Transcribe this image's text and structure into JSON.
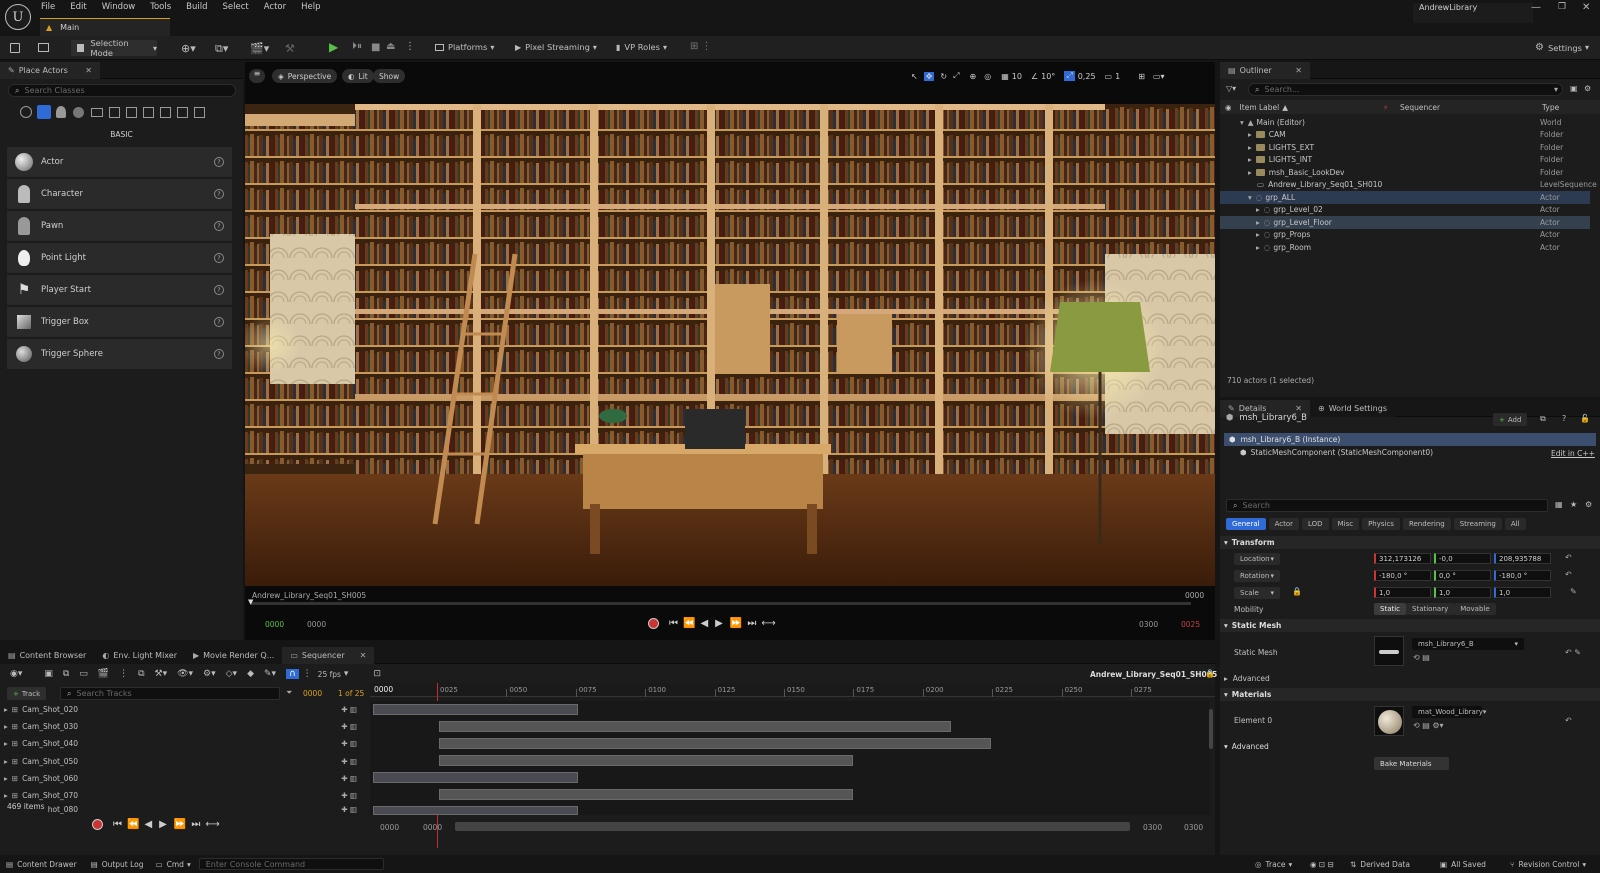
{
  "menu": {
    "items": [
      "File",
      "Edit",
      "Window",
      "Tools",
      "Build",
      "Select",
      "Actor",
      "Help"
    ],
    "project": "AndrewLibrary"
  },
  "tab": {
    "main": "Main"
  },
  "toolbar": {
    "selection_mode": "Selection Mode",
    "platforms": "Platforms",
    "pixel_streaming": "Pixel Streaming",
    "vp_roles": "VP Roles",
    "settings": "Settings"
  },
  "place_actors": {
    "title": "Place Actors",
    "search_placeholder": "Search Classes",
    "category": "BASIC",
    "items": [
      {
        "label": "Actor",
        "icon": "sphere-icon"
      },
      {
        "label": "Character",
        "icon": "character-icon"
      },
      {
        "label": "Pawn",
        "icon": "pawn-icon"
      },
      {
        "label": "Point Light",
        "icon": "bulb-icon"
      },
      {
        "label": "Player Start",
        "icon": "flag-icon"
      },
      {
        "label": "Trigger Box",
        "icon": "cube-icon"
      },
      {
        "label": "Trigger Sphere",
        "icon": "sphere-icon"
      }
    ]
  },
  "viewport": {
    "perspective": "Perspective",
    "lit": "Lit",
    "show": "Show",
    "grid": "10",
    "angle": "10°",
    "scale": "0,25",
    "cams": "1",
    "shot_name": "Andrew_Library_Seq01_SH005",
    "frame_right": "0000",
    "t_start": "0000",
    "t_start2": "0000",
    "t_end": "0300",
    "t_end2": "0025"
  },
  "outliner": {
    "title": "Outliner",
    "search_placeholder": "Search...",
    "col_label": "Item Label",
    "col_seq": "Sequencer",
    "col_type": "Type",
    "rows": [
      {
        "label": "Main (Editor)",
        "type": "World"
      },
      {
        "label": "CAM",
        "type": "Folder"
      },
      {
        "label": "LIGHTS_EXT",
        "type": "Folder"
      },
      {
        "label": "LIGHTS_INT",
        "type": "Folder"
      },
      {
        "label": "msh_Basic_LookDev",
        "type": "Folder"
      },
      {
        "label": "Andrew_Library_Seq01_SH010",
        "type": "LevelSequence"
      },
      {
        "label": "grp_ALL",
        "type": "Actor"
      },
      {
        "label": "grp_Level_02",
        "type": "Actor"
      },
      {
        "label": "grp_Level_Floor",
        "type": "Actor"
      },
      {
        "label": "grp_Props",
        "type": "Actor"
      },
      {
        "label": "grp_Room",
        "type": "Actor"
      }
    ],
    "status": "710 actors (1 selected)"
  },
  "details": {
    "title": "Details",
    "world_settings": "World Settings",
    "object": "msh_Library6_B",
    "add": "Add",
    "instance": "msh_Library6_B (Instance)",
    "component": "StaticMeshComponent (StaticMeshComponent0)",
    "edit_cpp": "Edit in C++",
    "search_placeholder": "Search",
    "filters": [
      "General",
      "Actor",
      "LOD",
      "Misc",
      "Physics",
      "Rendering",
      "Streaming",
      "All"
    ],
    "transform": "Transform",
    "location": "Location",
    "location_vals": [
      "312,173126",
      "-0,0",
      "208,935788"
    ],
    "rotation": "Rotation",
    "rotation_vals": [
      "-180,0 °",
      "0,0 °",
      "-180,0 °"
    ],
    "scale": "Scale",
    "scale_vals": [
      "1,0",
      "1,0",
      "1,0"
    ],
    "mobility": "Mobility",
    "mobility_opts": [
      "Static",
      "Stationary",
      "Movable"
    ],
    "static_mesh_section": "Static Mesh",
    "static_mesh_label": "Static Mesh",
    "static_mesh_val": "msh_Library6_B",
    "advanced": "Advanced",
    "materials": "Materials",
    "element0": "Element 0",
    "material_val": "mat_Wood_Library",
    "advanced2": "Advanced",
    "bake": "Bake Materials"
  },
  "bottom_tabs": [
    "Content Browser",
    "Env. Light Mixer",
    "Movie Render Q...",
    "Sequencer"
  ],
  "sequencer": {
    "fps": "25 fps",
    "sequence": "Andrew_Library_Seq01_SH005",
    "track": "Track",
    "search_placeholder": "Search Tracks",
    "frame": "0000",
    "of": "1 of 25",
    "playhead": "0000",
    "ticks": [
      "0025",
      "0050",
      "0075",
      "0100",
      "0125",
      "0150",
      "0175",
      "0200",
      "0225",
      "0250",
      "0275"
    ],
    "tracks": [
      "Cam_Shot_020",
      "Cam_Shot_030",
      "Cam_Shot_040",
      "Cam_Shot_050",
      "Cam_Shot_060",
      "Cam_Shot_070",
      "Cam_Shot_080"
    ],
    "items": "469 items",
    "l0": "0000",
    "l1": "0000",
    "r0": "0300",
    "r1": "0300"
  },
  "statusbar": {
    "drawer": "Content Drawer",
    "outlog": "Output Log",
    "cmd": "Cmd",
    "console_placeholder": "Enter Console Command",
    "trace": "Trace",
    "derived": "Derived Data",
    "saved": "All Saved",
    "revision": "Revision Control"
  }
}
